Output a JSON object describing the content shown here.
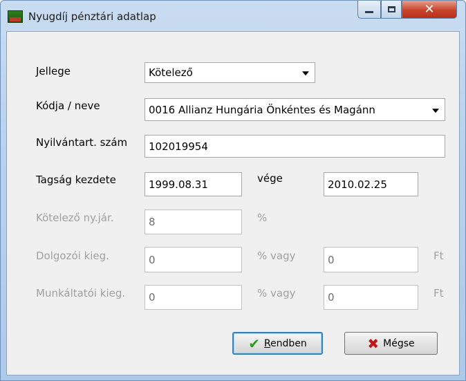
{
  "window": {
    "title": "Nyugdíj pénztári adatlap"
  },
  "form": {
    "jellege_label": "Jellege",
    "jellege_value": "Kötelező",
    "kodja_label": "Kódja / neve",
    "kodja_value": "0016 Allianz Hungária Önkéntes és Magánn",
    "nyilv_label": "Nyilvántart. szám",
    "nyilv_value": "102019954",
    "tagsag_label": "Tagság kezdete",
    "tagsag_value": "1999.08.31",
    "vege_label": "vége",
    "vege_value": "2010.02.25",
    "kotelezo_label": "Kötelező ny.jár.",
    "kotelezo_value": "8",
    "kotelezo_unit": "%",
    "dolgozoi_label": "Dolgozói kieg.",
    "dolgozoi_pct": "0",
    "dolgozoi_vagy": "% vagy",
    "dolgozoi_ft": "0",
    "dolgozoi_ft_unit": "Ft",
    "munkaltatoi_label": "Munkáltatói kieg.",
    "munkaltatoi_pct": "0",
    "munkaltatoi_vagy": "% vagy",
    "munkaltatoi_ft": "0",
    "munkaltatoi_ft_unit": "Ft"
  },
  "buttons": {
    "ok_first": "R",
    "ok_rest": "endben",
    "cancel_label": "Mégse"
  },
  "icons": {
    "app": "app-icon",
    "ok": "checkmark-icon",
    "cancel": "x-icon"
  }
}
